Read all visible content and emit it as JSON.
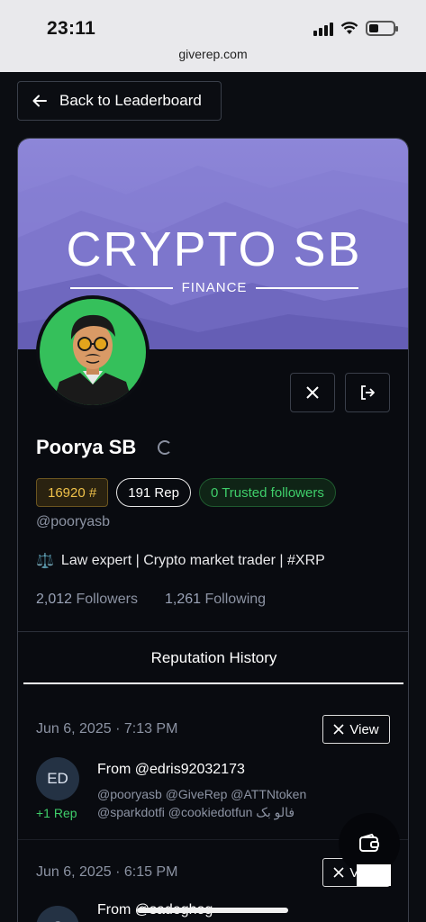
{
  "status_bar": {
    "time": "23:11",
    "url": "giverep.com"
  },
  "nav": {
    "back_label": "Back to Leaderboard"
  },
  "banner": {
    "brand": "CRYPTO SB",
    "brand_sub": "FINANCE"
  },
  "profile": {
    "name": "Poorya SB",
    "rank": "16920 #",
    "rep": "191 Rep",
    "trusted": "0 Trusted followers",
    "handle": "@pooryasb",
    "bio_emoji": "⚖️",
    "bio": "Law expert | Crypto market trader | #XRP",
    "followers_count": "2,012",
    "followers_label": "Followers",
    "following_count": "1,261",
    "following_label": "Following"
  },
  "reputation": {
    "title": "Reputation History",
    "entries": [
      {
        "date": "Jun 6, 2025 · 7:13 PM",
        "view_label": "View",
        "initials": "ED",
        "delta": "+1 Rep",
        "from": "From @edris92032173",
        "mentions_line1": "@pooryasb @GiveRep @ATTNtoken",
        "mentions_line2": "@sparkdotfi @cookiedotfun فالو بک"
      },
      {
        "date": "Jun 6, 2025 · 6:15 PM",
        "view_label": "View",
        "initials": "S",
        "from": "From @sadeghog"
      }
    ]
  },
  "colors": {
    "banner": "#8d86d8",
    "accent_green": "#3fce6a",
    "rank_gold": "#f0c24a"
  }
}
